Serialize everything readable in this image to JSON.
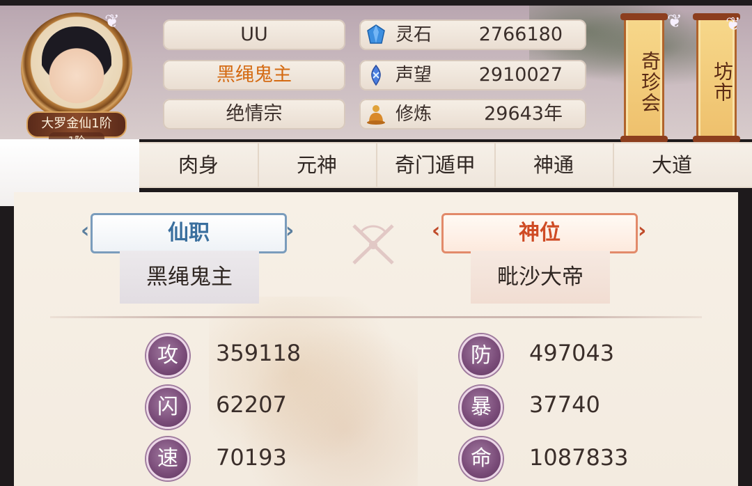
{
  "profile": {
    "name": "UU",
    "title": "黑绳鬼主",
    "sect": "绝情宗",
    "rank": "大罗金仙1阶",
    "rank_sub": "1阶"
  },
  "resources": [
    {
      "icon": "spirit-stone-icon",
      "label": "灵石",
      "value": "2766180"
    },
    {
      "icon": "prestige-icon",
      "label": "声望",
      "value": "2910027"
    },
    {
      "icon": "cultivation-icon",
      "label": "修炼",
      "value": "29643年"
    }
  ],
  "side_buttons": [
    {
      "label": "奇珍会"
    },
    {
      "label": "坊市"
    }
  ],
  "tabs": [
    "肉身",
    "元神",
    "奇门遁甲",
    "神通",
    "大道"
  ],
  "roles": {
    "left": {
      "header": "仙职",
      "value": "黑绳鬼主"
    },
    "right": {
      "header": "神位",
      "value": "毗沙大帝"
    }
  },
  "stats": [
    {
      "glyph": "攻",
      "value": "359118"
    },
    {
      "glyph": "防",
      "value": "497043"
    },
    {
      "glyph": "闪",
      "value": "62207"
    },
    {
      "glyph": "暴",
      "value": "37740"
    },
    {
      "glyph": "速",
      "value": "70193"
    },
    {
      "glyph": "命",
      "value": "1087833"
    }
  ],
  "colors": {
    "accent_orange": "#d46a12",
    "blue_header": "#3a6f9e",
    "red_header": "#cf4b24",
    "stat_icon": "#7c4e7b"
  }
}
